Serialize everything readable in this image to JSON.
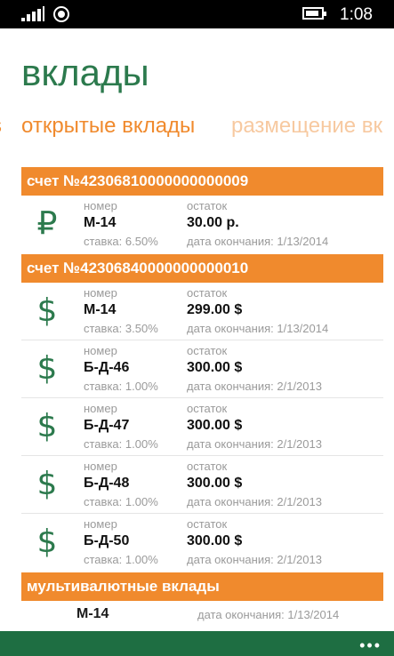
{
  "status": {
    "time": "1:08"
  },
  "page": {
    "title": "вклады"
  },
  "pivot": {
    "prev_fragment": "s",
    "active": "открытые вклады",
    "next": "размещение вк"
  },
  "labels": {
    "number": "номер",
    "balance": "остаток",
    "rate": "ставка:",
    "end_date": "дата окончания:"
  },
  "groups": [
    {
      "title": "счет №42306810000000000009",
      "deposits": [
        {
          "symbol": "₽",
          "number": "М-14",
          "balance": "30.00 р.",
          "rate": "6.50%",
          "end_date": "1/13/2014"
        }
      ]
    },
    {
      "title": "счет №42306840000000000010",
      "deposits": [
        {
          "symbol": "$",
          "number": "М-14",
          "balance": "299.00 $",
          "rate": "3.50%",
          "end_date": "1/13/2014"
        },
        {
          "symbol": "$",
          "number": "Б-Д-46",
          "balance": "300.00 $",
          "rate": "1.00%",
          "end_date": "2/1/2013"
        },
        {
          "symbol": "$",
          "number": "Б-Д-47",
          "balance": "300.00 $",
          "rate": "1.00%",
          "end_date": "2/1/2013"
        },
        {
          "symbol": "$",
          "number": "Б-Д-48",
          "balance": "300.00 $",
          "rate": "1.00%",
          "end_date": "2/1/2013"
        },
        {
          "symbol": "$",
          "number": "Б-Д-50",
          "balance": "300.00 $",
          "rate": "1.00%",
          "end_date": "2/1/2013"
        }
      ]
    }
  ],
  "multi": {
    "title": "мультивалютные вклады",
    "number": "М-14",
    "end_date": "1/13/2014"
  },
  "appbar": {
    "more": "•••"
  }
}
